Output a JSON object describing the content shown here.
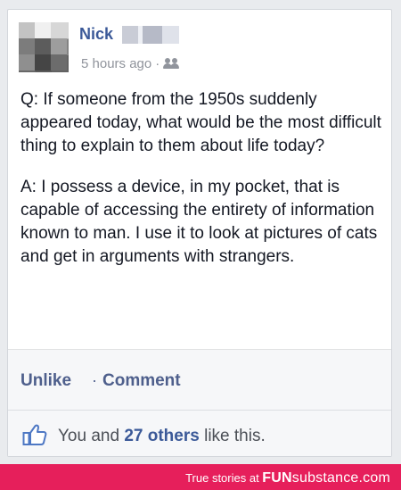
{
  "post": {
    "author_name": "Nick",
    "timestamp": "5 hours ago",
    "separator": "·",
    "audience_icon": "friends-icon",
    "question": "Q: If someone from the 1950s suddenly appeared today, what would be the most difficult thing to explain to them about life today?",
    "answer": "A: I possess a device, in my pocket, that is capable of accessing the entirety of information known to man. I use it to look at pictures of cats and get in arguments with strangers."
  },
  "actions": {
    "unlike_label": "Unlike",
    "separator": "·",
    "comment_label": "Comment"
  },
  "likes": {
    "icon": "thumbs-up-icon",
    "prefix": "You and ",
    "others": "27 others",
    "suffix": " like this."
  },
  "footer": {
    "tagline_prefix": "True stories at ",
    "brand_bold": "FUN",
    "brand_rest": "substance.com",
    "color": "#e61f5b"
  },
  "colors": {
    "link": "#3b5998",
    "action": "#4e5f8c",
    "meta": "#90949c"
  }
}
